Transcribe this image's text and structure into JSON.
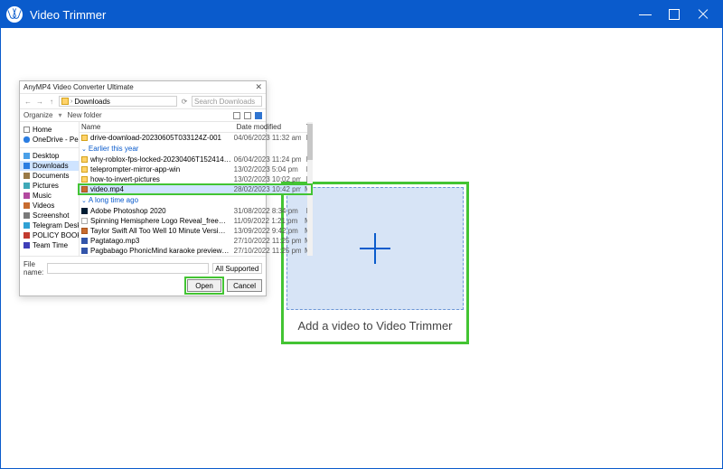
{
  "app": {
    "title": "Video Trimmer"
  },
  "dropzone": {
    "label": "Add a video to Video Trimmer"
  },
  "dialog": {
    "title": "AnyMP4 Video Converter Ultimate",
    "breadcrumb_icon": "folder",
    "breadcrumb": "Downloads",
    "search_placeholder": "Search Downloads",
    "organize": "Organize",
    "new_folder": "New folder",
    "columns": {
      "name": "Name",
      "date": "Date modified",
      "type": "T"
    },
    "tree": [
      {
        "label": "Home",
        "icon": "t-home"
      },
      {
        "label": "OneDrive - Pers…",
        "icon": "t-cloud"
      },
      {
        "__divider": true
      },
      {
        "label": "Desktop",
        "icon": "t-desk"
      },
      {
        "label": "Downloads",
        "icon": "t-down",
        "selected": true
      },
      {
        "label": "Documents",
        "icon": "t-doc"
      },
      {
        "label": "Pictures",
        "icon": "t-pic"
      },
      {
        "label": "Music",
        "icon": "t-mus"
      },
      {
        "label": "Videos",
        "icon": "t-vid"
      },
      {
        "label": "Screenshot",
        "icon": "t-shot"
      },
      {
        "label": "Telegram Desk…",
        "icon": "t-tg"
      },
      {
        "label": "POLICY BOOKL…",
        "icon": "t-pdf"
      },
      {
        "label": "Team Time",
        "icon": "t-team"
      }
    ],
    "groups": [
      {
        "rows": [
          {
            "icon": "f-ic",
            "name": "drive-download-20230605T033124Z-001",
            "date": "04/06/2023 11:32 am",
            "type": "F"
          }
        ]
      },
      {
        "title": "Earlier this year",
        "rows": [
          {
            "icon": "f-ic",
            "name": "why-roblox-fps-locked-20230406T152414…",
            "date": "06/04/2023 11:24 pm",
            "type": "F"
          },
          {
            "icon": "f-ic",
            "name": "teleprompter-mirror-app-win",
            "date": "13/02/2023 5:04 pm",
            "type": "F"
          },
          {
            "icon": "f-ic",
            "name": "how-to-invert-pictures",
            "date": "13/02/2023 10:02 pm",
            "type": "F"
          },
          {
            "icon": "f-ic vid",
            "name": "video.mp4",
            "date": "28/02/2023 10:42 pm",
            "type": "M",
            "selected": true
          }
        ]
      },
      {
        "title": "A long time ago",
        "rows": [
          {
            "icon": "f-ic ps",
            "name": "Adobe Photoshop 2020",
            "date": "31/08/2022 8:34 pm",
            "type": "F"
          },
          {
            "icon": "f-ic pdf",
            "name": "Spinning Hemisphere Logo Reveal_free…",
            "date": "11/09/2022 1:21 pm",
            "type": "M"
          },
          {
            "icon": "f-ic vid",
            "name": "Taylor Swift  All Too Well 10 Minute Versi…",
            "date": "13/09/2022 9:42 pm",
            "type": "M"
          },
          {
            "icon": "f-ic mp3",
            "name": "Pagtatago.mp3",
            "date": "27/10/2022 11:25 pm",
            "type": "M"
          },
          {
            "icon": "f-ic mp3",
            "name": "Pagbabago PhonicMind karaoke preview…",
            "date": "27/10/2022 11:25 pm",
            "type": "M"
          }
        ]
      }
    ],
    "filename_label": "File name:",
    "filename_value": "",
    "filter": "All Supported Formats (*.ts;*.m…",
    "open": "Open",
    "cancel": "Cancel"
  }
}
